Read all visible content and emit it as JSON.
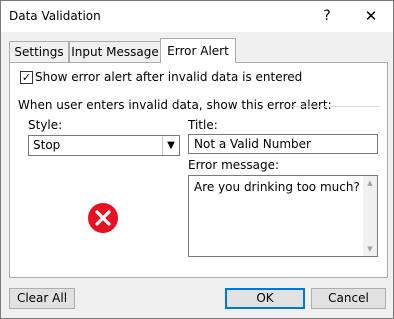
{
  "window": {
    "title": "Data Validation",
    "help_glyph": "?",
    "close_glyph": "✕"
  },
  "tabs": [
    {
      "label": "Settings",
      "active": false
    },
    {
      "label": "Input Message",
      "active": false
    },
    {
      "label": "Error Alert",
      "active": true
    }
  ],
  "error_alert": {
    "show_alert_checked": true,
    "show_alert_label": "Show error alert after invalid data is entered",
    "group_label": "When user enters invalid data, show this error alert:",
    "style_label": "Style:",
    "style_value": "Stop",
    "title_label": "Title:",
    "title_value": "Not a Valid Number",
    "message_label": "Error message:",
    "message_value": "Are you drinking too much?",
    "icon": "error-stop-icon",
    "icon_color": "#e81123"
  },
  "buttons": {
    "clear_all": "Clear All",
    "ok": "OK",
    "cancel": "Cancel"
  },
  "colors": {
    "accent": "#0078d7",
    "panel_bg": "#ffffff",
    "dialog_bg": "#f0f0f0"
  }
}
